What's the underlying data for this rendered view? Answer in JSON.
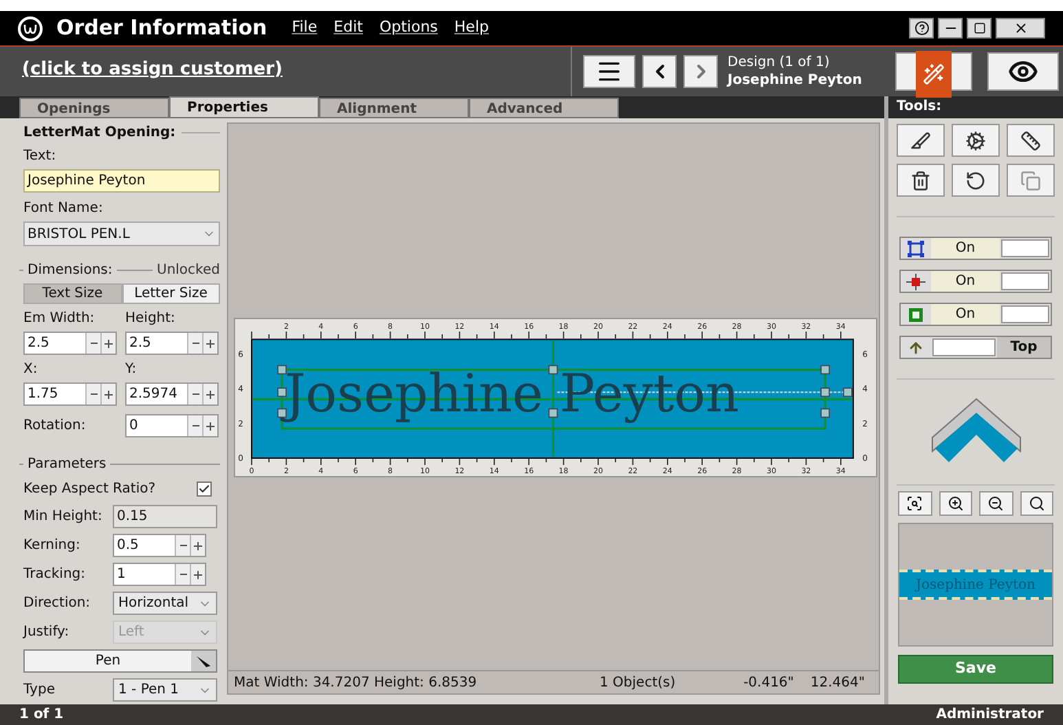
{
  "window": {
    "title": "Order Information",
    "menu": [
      "File",
      "Edit",
      "Options",
      "Help"
    ]
  },
  "customer_link": "(click to assign customer)",
  "design": {
    "caption": "Design  (1 of 1)",
    "name": "Josephine Peyton"
  },
  "tabs": [
    {
      "label": "Openings",
      "selected": false
    },
    {
      "label": "Properties",
      "selected": true
    },
    {
      "label": "Alignment",
      "selected": false
    },
    {
      "label": "Advanced",
      "selected": false
    }
  ],
  "properties": {
    "heading": "LetterMat Opening:",
    "text_label": "Text:",
    "text_value": "Josephine Peyton",
    "font_label": "Font Name:",
    "font_value": "BRISTOL PEN.L",
    "dimensions_label": "Dimensions:",
    "lock_label": "Unlocked",
    "size_modes": [
      {
        "label": "Text Size",
        "selected": false
      },
      {
        "label": "Letter Size",
        "selected": true
      }
    ],
    "pairs": [
      [
        {
          "label": "Em Width:",
          "value": "2.5"
        },
        {
          "label": "Height:",
          "value": "2.5"
        }
      ],
      [
        {
          "label": "X:",
          "value": "1.75"
        },
        {
          "label": "Y:",
          "value": "2.5974"
        }
      ]
    ],
    "rotation": {
      "label": "Rotation:",
      "value": "0"
    },
    "parameters_label": "Parameters",
    "parameters": [
      {
        "kind": "checkbox",
        "label": "Keep Aspect Ratio?",
        "checked": true
      },
      {
        "kind": "readonly",
        "label": "Min Height:",
        "value": "0.15"
      },
      {
        "kind": "spinner",
        "label": "Kerning:",
        "value": "0.5"
      },
      {
        "kind": "spinner",
        "label": "Tracking:",
        "value": "1"
      },
      {
        "kind": "select",
        "label": "Direction:",
        "value": "Horizontal",
        "disabled": false
      },
      {
        "kind": "select",
        "label": "Justify:",
        "value": "Left",
        "disabled": true
      },
      {
        "kind": "pen",
        "label": "Pen"
      },
      {
        "kind": "select",
        "label": "Type",
        "value": "1 - Pen 1",
        "disabled": false
      }
    ]
  },
  "canvas": {
    "mat_text": "Josephine Peyton",
    "top_ruler": [
      "2",
      "4",
      "6",
      "8",
      "10",
      "12",
      "14",
      "16",
      "18",
      "20",
      "22",
      "24",
      "26",
      "28",
      "30",
      "32",
      "34"
    ],
    "bottom_ruler": [
      "0",
      "2",
      "4",
      "6",
      "8",
      "10",
      "12",
      "14",
      "16",
      "18",
      "20",
      "22",
      "24",
      "26",
      "28",
      "30",
      "32",
      "34"
    ],
    "left_ruler": [
      "6",
      "4",
      "2",
      "0"
    ],
    "right_ruler": [
      "6",
      "4",
      "2",
      "0"
    ],
    "status": {
      "mat": "Mat  Width: 34.7207  Height: 6.8539",
      "objects": "1 Object(s)",
      "x": "-0.416\"",
      "y": "12.464\""
    }
  },
  "tools": {
    "title": "Tools:",
    "toggles": [
      {
        "label": "On",
        "on": true
      },
      {
        "label": "On",
        "on": true
      },
      {
        "label": "On",
        "on": true
      },
      {
        "label": "Top",
        "on": false
      }
    ],
    "preview_text": "Josephine Peyton",
    "save": "Save"
  },
  "status_bar": {
    "left": "1 of 1",
    "right": "Administrator"
  }
}
